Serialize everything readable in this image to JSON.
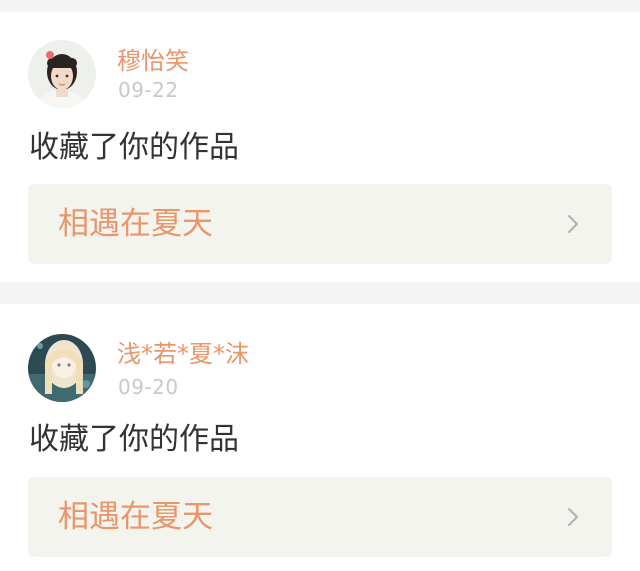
{
  "theme": {
    "accent": "#e8966b",
    "text": "#333333",
    "muted": "#c8c8c8",
    "link_bg": "#f4f4ef"
  },
  "notifications": [
    {
      "username": "穆怡笑",
      "date": "09-22",
      "action": "收藏了你的作品",
      "work_title": "相遇在夏天",
      "avatar_icon": "user-avatar-photo"
    },
    {
      "username": "浅*若*夏*沫",
      "date": "09-20",
      "action": "收藏了你的作品",
      "work_title": "相遇在夏天",
      "avatar_icon": "user-avatar-anime"
    }
  ]
}
